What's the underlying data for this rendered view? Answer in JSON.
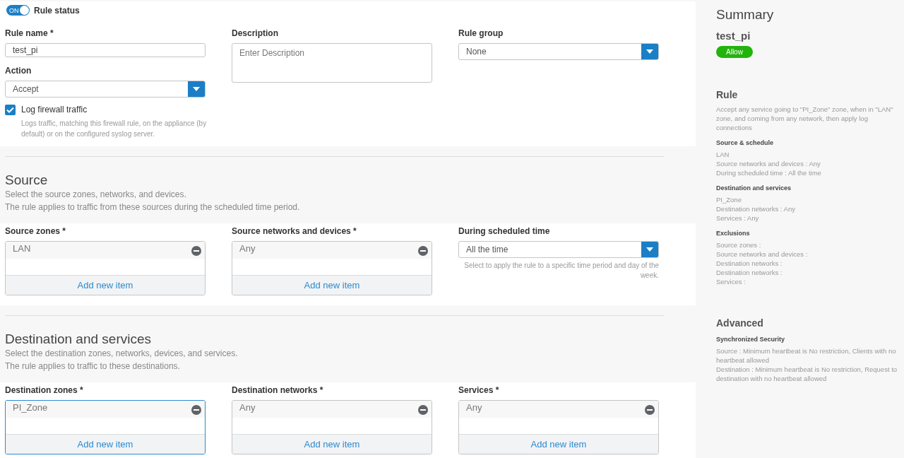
{
  "rule_status": {
    "toggle_text": "ON",
    "on": true,
    "label": "Rule status"
  },
  "general": {
    "rule_name": {
      "label": "Rule name *",
      "value": "test_pi"
    },
    "action": {
      "label": "Action",
      "value": "Accept"
    },
    "log": {
      "label": "Log firewall traffic",
      "checked": true,
      "hint": "Logs traffic, matching this firewall rule, on the appliance (by default) or on the configured syslog server."
    },
    "description": {
      "label": "Description",
      "placeholder": "Enter Description"
    },
    "rule_group": {
      "label": "Rule group",
      "value": "None"
    }
  },
  "sections": [
    {
      "title": "Source",
      "subtitle_lines": [
        "Select the source zones, networks, and devices.",
        "The rule applies to traffic from these sources during the scheduled time period."
      ],
      "fields": [
        {
          "kind": "list",
          "label": "Source zones *",
          "items": [
            "LAN"
          ],
          "focused": false,
          "add_label": "Add new item"
        },
        {
          "kind": "list",
          "label": "Source networks and devices *",
          "items": [
            "Any"
          ],
          "focused": false,
          "add_label": "Add new item"
        },
        {
          "kind": "select",
          "label": "During scheduled time",
          "value": "All the time",
          "hint": "Select to apply the rule to a specific time period and day of the week."
        }
      ]
    },
    {
      "title": "Destination and services",
      "subtitle_lines": [
        "Select the destination zones, networks, devices, and services.",
        "The rule applies to traffic to these destinations."
      ],
      "fields": [
        {
          "kind": "list",
          "label": "Destination zones *",
          "items": [
            "PI_Zone"
          ],
          "focused": true,
          "add_label": "Add new item"
        },
        {
          "kind": "list",
          "label": "Destination networks *",
          "items": [
            "Any"
          ],
          "focused": false,
          "add_label": "Add new item"
        },
        {
          "kind": "list",
          "label": "Services *",
          "items": [
            "Any"
          ],
          "focused": false,
          "add_label": "Add new item"
        }
      ]
    }
  ],
  "summary": {
    "title": "Summary",
    "rule_name": "test_pi",
    "badge": "Allow",
    "blocks": [
      {
        "kind": "heading",
        "text": "Rule"
      },
      {
        "kind": "text",
        "text": "Accept any service going to \"PI_Zone\" zone, when in \"LAN\" zone, and coming from any network, then apply log connections"
      },
      {
        "kind": "subheading",
        "text": "Source & schedule"
      },
      {
        "kind": "text",
        "text": "LAN"
      },
      {
        "kind": "text",
        "text": "Source networks and devices : Any"
      },
      {
        "kind": "text",
        "text": "During scheduled time : All the time"
      },
      {
        "kind": "subheading",
        "text": "Destination and services"
      },
      {
        "kind": "text",
        "text": "PI_Zone"
      },
      {
        "kind": "text",
        "text": "Destination networks : Any"
      },
      {
        "kind": "text",
        "text": "Services : Any"
      },
      {
        "kind": "subheading",
        "text": "Exclusions"
      },
      {
        "kind": "text",
        "text": "Source zones :"
      },
      {
        "kind": "text",
        "text": "Source networks and devices :"
      },
      {
        "kind": "text",
        "text": "Destination networks :"
      },
      {
        "kind": "text",
        "text": "Destination networks :"
      },
      {
        "kind": "text",
        "text": "Services :"
      },
      {
        "kind": "heading",
        "text": "Advanced"
      },
      {
        "kind": "subheading",
        "text": "Synchronized Security"
      },
      {
        "kind": "text",
        "text": "Source : Minimum heartbeat is No restriction, Clients with no heartbeat allowed"
      },
      {
        "kind": "text",
        "text": "Destination : Minimum heartbeat is No restriction, Request to destination with no heartbeat allowed"
      }
    ]
  }
}
